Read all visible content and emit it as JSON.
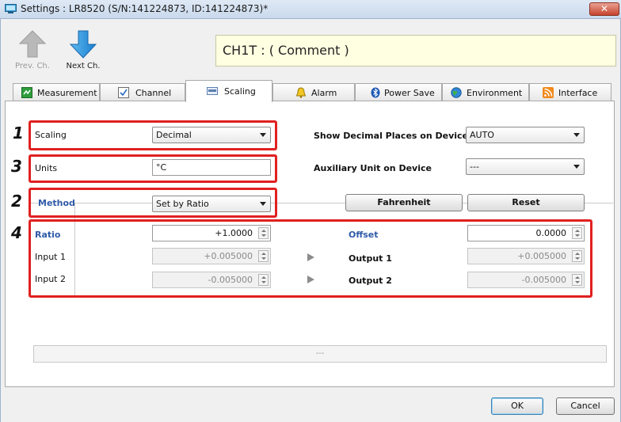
{
  "window": {
    "title": "Settings : LR8520 (S/N:141224873, ID:141224873)*",
    "close_label": "✕"
  },
  "nav": {
    "prev_label": "Prev. Ch.",
    "next_label": "Next Ch.",
    "comment": "CH1T : ( Comment )"
  },
  "tabs": [
    {
      "label": "Measurement",
      "icon": "measurement-icon"
    },
    {
      "label": "Channel",
      "icon": "channel-check-icon"
    },
    {
      "label": "Scaling",
      "icon": "scaling-icon",
      "active": true
    },
    {
      "label": "Alarm",
      "icon": "bell-icon"
    },
    {
      "label": "Power Save",
      "icon": "bluetooth-icon"
    },
    {
      "label": "Environment",
      "icon": "globe-icon"
    },
    {
      "label": "Interface",
      "icon": "rss-icon"
    }
  ],
  "form": {
    "scaling_label": "Scaling",
    "scaling_value": "Decimal",
    "units_label": "Units",
    "units_value": "°C",
    "show_decimal_label": "Show Decimal Places on Device",
    "show_decimal_value": "AUTO",
    "aux_unit_label": "Auxiliary Unit on Device",
    "aux_unit_value": "---",
    "method_label": "Method",
    "method_value": "Set by Ratio",
    "fahrenheit_label": "Fahrenheit",
    "reset_label": "Reset",
    "ratio_label": "Ratio",
    "ratio_value": "+1.0000",
    "offset_label": "Offset",
    "offset_value": "0.0000",
    "input1_label": "Input 1",
    "input1_value": "+0.005000",
    "output1_label": "Output 1",
    "output1_value": "+0.005000",
    "input2_label": "Input 2",
    "input2_value": "-0.005000",
    "output2_label": "Output 2",
    "output2_value": "-0.005000",
    "status_text": "---"
  },
  "annotations": {
    "n1": "1",
    "n2": "2",
    "n3": "3",
    "n4": "4"
  },
  "dialog": {
    "ok_label": "OK",
    "cancel_label": "Cancel"
  },
  "colors": {
    "annotation_red": "#e02020",
    "accent_blue": "#2f5aa8",
    "comment_bg": "#ffffe1"
  }
}
